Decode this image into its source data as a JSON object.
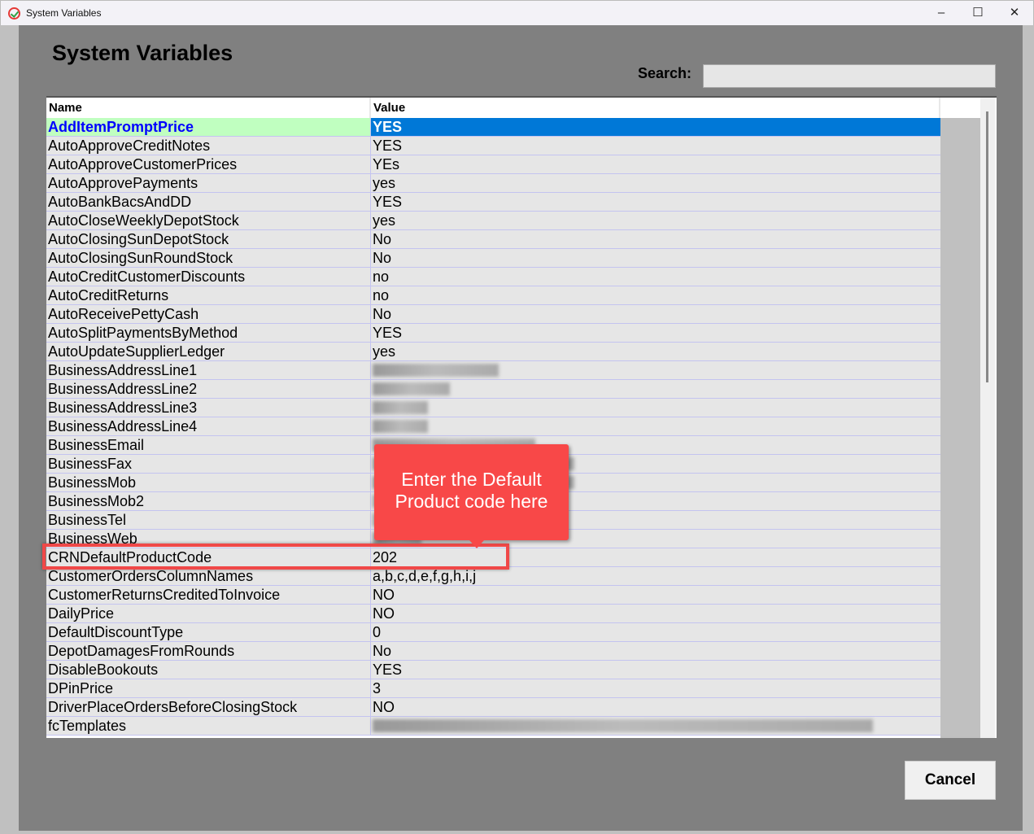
{
  "window": {
    "title": "System Variables",
    "minimize": "–",
    "maximize": "☐",
    "close": "✕"
  },
  "header": {
    "title": "System Variables",
    "search_label": "Search:",
    "search_value": ""
  },
  "table": {
    "columns": [
      "Name",
      "Value"
    ],
    "rows": [
      {
        "name": "AddItemPromptPrice",
        "value": "YES",
        "selected": true
      },
      {
        "name": "AutoApproveCreditNotes",
        "value": "YES"
      },
      {
        "name": "AutoApproveCustomerPrices",
        "value": "YEs"
      },
      {
        "name": "AutoApprovePayments",
        "value": "yes"
      },
      {
        "name": "AutoBankBacsAndDD",
        "value": "YES"
      },
      {
        "name": "AutoCloseWeeklyDepotStock",
        "value": "yes"
      },
      {
        "name": "AutoClosingSunDepotStock",
        "value": "No"
      },
      {
        "name": "AutoClosingSunRoundStock",
        "value": "No"
      },
      {
        "name": "AutoCreditCustomerDiscounts",
        "value": "no"
      },
      {
        "name": "AutoCreditReturns",
        "value": "no"
      },
      {
        "name": "AutoReceivePettyCash",
        "value": "No"
      },
      {
        "name": "AutoSplitPaymentsByMethod",
        "value": "YES"
      },
      {
        "name": "AutoUpdateSupplierLedger",
        "value": "yes"
      },
      {
        "name": "BusinessAddressLine1",
        "value": "",
        "redacted": true
      },
      {
        "name": "BusinessAddressLine2",
        "value": "",
        "redacted": true
      },
      {
        "name": "BusinessAddressLine3",
        "value": "",
        "redacted": true
      },
      {
        "name": "BusinessAddressLine4",
        "value": "",
        "redacted": true
      },
      {
        "name": "BusinessEmail",
        "value": "",
        "redacted": true
      },
      {
        "name": "BusinessFax",
        "value": "",
        "redacted": true
      },
      {
        "name": "BusinessMob",
        "value": "",
        "redacted": true
      },
      {
        "name": "BusinessMob2",
        "value": "",
        "redacted": true
      },
      {
        "name": "BusinessTel",
        "value": "",
        "redacted": true
      },
      {
        "name": "BusinessWeb",
        "value": "",
        "redacted": true
      },
      {
        "name": "CRNDefaultProductCode",
        "value": "202",
        "highlighted": true
      },
      {
        "name": "CustomerOrdersColumnNames",
        "value": "a,b,c,d,e,f,g,h,i,j"
      },
      {
        "name": "CustomerReturnsCreditedToInvoice",
        "value": "NO"
      },
      {
        "name": "DailyPrice",
        "value": "NO"
      },
      {
        "name": "DefaultDiscountType",
        "value": "0"
      },
      {
        "name": "DepotDamagesFromRounds",
        "value": "No"
      },
      {
        "name": "DisableBookouts",
        "value": "YES"
      },
      {
        "name": "DPinPrice",
        "value": "3"
      },
      {
        "name": "DriverPlaceOrdersBeforeClosingStock",
        "value": "NO"
      },
      {
        "name": "fcTemplates",
        "value": "",
        "redacted": true
      }
    ]
  },
  "callout": {
    "line1": "Enter the Default",
    "line2": "Product code here"
  },
  "footer": {
    "cancel_label": "Cancel"
  },
  "colors": {
    "selected_name_bg": "#c0ffc0",
    "selected_value_bg": "#0078d7",
    "callout": "#f84848",
    "dialog_bg": "#808080"
  }
}
